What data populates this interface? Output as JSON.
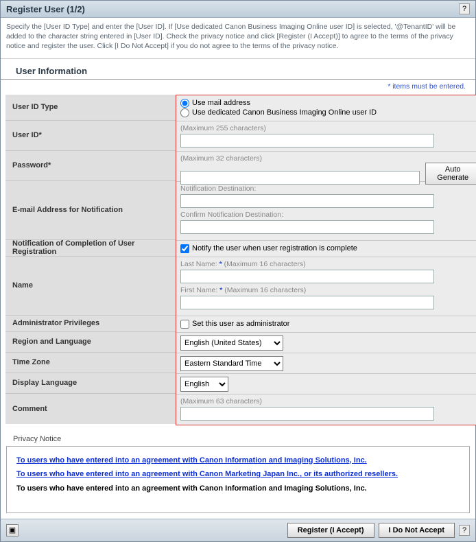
{
  "title": "Register User (1/2)",
  "help_glyph": "?",
  "instructions": "Specify the [User ID Type] and enter the [User ID]. If [Use dedicated Canon Business Imaging Online user ID] is selected, '@TenantID' will be added to the character string entered in [User ID]. Check the privacy notice and click [Register (I Accept)] to agree to the terms of the privacy notice and register the user. Click [I Do Not Accept] if you do not agree to the terms of the privacy notice.",
  "section_title": "User Information",
  "required_note": "* items must be entered.",
  "labels": {
    "user_id_type": "User ID Type",
    "user_id": "User ID",
    "password": "Password",
    "email_notif": "E-mail Address for Notification",
    "reg_complete": "Notification of Completion of User Registration",
    "name": "Name",
    "admin": "Administrator Privileges",
    "region": "Region and Language",
    "timezone": "Time Zone",
    "display_lang": "Display Language",
    "comment": "Comment"
  },
  "values": {
    "radio_mail": "Use mail address",
    "radio_dedicated": "Use dedicated Canon Business Imaging Online user ID",
    "hint_255": "(Maximum 255 characters)",
    "hint_32": "(Maximum 32 characters)",
    "auto_generate": "Auto Generate",
    "notif_dest": "Notification Destination:",
    "confirm_notif_dest": "Confirm Notification Destination:",
    "notify_check": "Notify the user when user registration is complete",
    "last_name": "Last Name:",
    "first_name": "First Name:",
    "hint_16": "(Maximum 16 characters)",
    "admin_check": "Set this user as administrator",
    "region_value": "English (United States)",
    "timezone_value": "Eastern Standard Time",
    "display_lang_value": "English",
    "hint_63": "(Maximum 63 characters)"
  },
  "privacy": {
    "header": "Privacy Notice",
    "link1": "To users who have entered into an agreement with Canon Information and Imaging Solutions, Inc.",
    "link2": "To users who have entered into an agreement with Canon Marketing Japan Inc., or its authorized resellers.",
    "plain": "To users who have entered into an agreement with Canon Information and Imaging Solutions, Inc."
  },
  "footer": {
    "collapse_glyph": "▣",
    "register": "Register (I Accept)",
    "decline": "I Do Not Accept",
    "help": "?"
  }
}
